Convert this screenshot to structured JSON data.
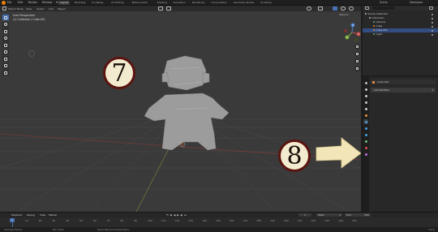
{
  "app_menu": [
    "File",
    "Edit",
    "Render",
    "Window",
    "Help"
  ],
  "workspaces": [
    "Layout",
    "Modeling",
    "Sculpting",
    "UV Editing",
    "Texture Paint",
    "Shading",
    "Animation",
    "Rendering",
    "Compositing",
    "Geometry Nodes",
    "Scripting"
  ],
  "active_workspace": "Layout",
  "scene_name": "Scene",
  "view_layer": "ViewLayer",
  "viewport": {
    "mode": "Object Mode",
    "menu": [
      "View",
      "Select",
      "Add",
      "Object"
    ],
    "overlay_title": "User Perspective",
    "overlay_subtitle": "(1) Collection | Cube.001",
    "options_label": "Options",
    "axis_labels": [
      "X",
      "Y",
      "Z"
    ]
  },
  "outliner": {
    "rows": [
      {
        "label": "Scene Collection",
        "color": "#bbbbbb",
        "indent": 0
      },
      {
        "label": "Collection",
        "color": "#bbbbbb",
        "indent": 1
      },
      {
        "label": "Camera",
        "color": "#5fa86e",
        "indent": 2
      },
      {
        "label": "Cube",
        "color": "#e08d3c",
        "indent": 2
      },
      {
        "label": "Cube.001",
        "color": "#e08d3c",
        "indent": 2
      },
      {
        "label": "Light",
        "color": "#5fa86e",
        "indent": 2
      }
    ],
    "selected_index": 4
  },
  "properties": {
    "object_name": "Cube.001",
    "add_modifier": "Add Modifier",
    "tab_colors": [
      "#bbbbbb",
      "#cccccc",
      "#cccccc",
      "#cccccc",
      "#cccccc",
      "#e08d3c",
      "#4a9fe0",
      "#4a9fe0",
      "#4a9fe0",
      "#6fbf73",
      "#e05050",
      "#c06fe0"
    ],
    "active_tab": 6
  },
  "timeline": {
    "menu": [
      "Playback",
      "Keying",
      "View",
      "Marker"
    ],
    "current_frame": "1",
    "start_label": "Start",
    "start": "1",
    "end_label": "End",
    "end": "250",
    "ticks": [
      "0",
      "10",
      "20",
      "30",
      "40",
      "50",
      "60",
      "70",
      "80",
      "90",
      "100",
      "110",
      "120",
      "130",
      "140",
      "150",
      "160",
      "170",
      "180",
      "190",
      "200",
      "210",
      "220",
      "230",
      "240",
      "250"
    ]
  },
  "status": {
    "left": "Change Frame",
    "mid": "Pan View",
    "right": "Open Blend Context Menu",
    "version": "3.0.0"
  },
  "annotations": {
    "step_a": "7",
    "step_b": "8"
  }
}
